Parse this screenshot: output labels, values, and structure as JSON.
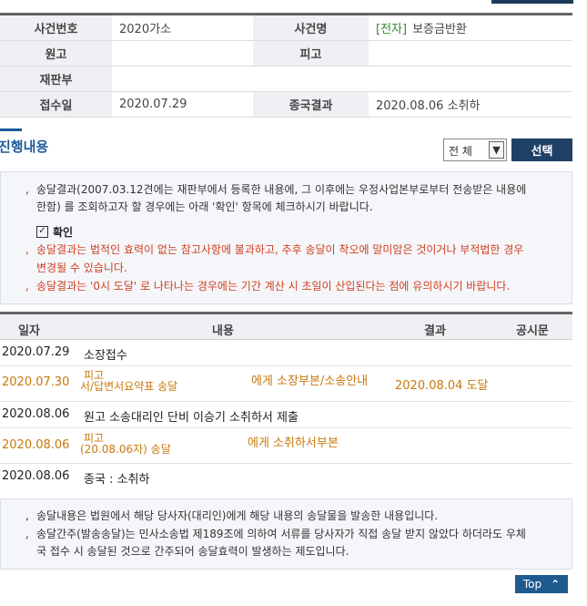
{
  "case_info": {
    "case_number_label": "사건번호",
    "case_number": "2020가소",
    "case_name_label": "사건명",
    "case_name_tag": "[전자]",
    "case_name": "보증금반환",
    "plaintiff_label": "원고",
    "plaintiff": "",
    "defendant_label": "피고",
    "defendant": "",
    "court_label": "재판부",
    "court": "",
    "filing_date_label": "접수일",
    "filing_date": "2020.07.29",
    "result_label": "종국결과",
    "result": "2020.08.06 소취하"
  },
  "progress_section": {
    "title": "진행내용",
    "filter_value": "전 체",
    "select_button": "선택"
  },
  "notice": {
    "line1a": "송달결과(2007.03.12견에는 재판부에서 등록한 내용에, 그 이후에는 우정사업본부로부터 전송받은 내용에",
    "line1b": "한함) 를 조회하고자 할 경우에는 아래 '확인' 항목에 체크하시기 바랍니다.",
    "confirm_label": "확인",
    "line2a": "송달결과는 법적인 효력이 없는 참고사항에 불과하고, 추후 송달이 착오에 말미암은 것이거나 부적법한 경우",
    "line2b": "변경될 수 있습니다.",
    "line3": "송달결과는 '0시 도달' 로 나타나는 경우에는 기간 계산 시 초일이 산입된다는 점에 유의하시기 바랍니다."
  },
  "progress_table": {
    "headers": {
      "date": "일자",
      "content": "내용",
      "result": "결과",
      "notice": "공시문"
    },
    "rows": [
      {
        "date": "2020.07.29",
        "content": "소장접수",
        "content2": "",
        "content_extra": "",
        "result": ""
      },
      {
        "date": "2020.07.30",
        "content": "피고",
        "content2": "서/답변서요약표 송달",
        "content_extra": "에게 소장부본/소송안내",
        "result": "2020.08.04 도달"
      },
      {
        "date": "2020.08.06",
        "content": "원고 소송대리인 단비 이승기 소취하서 제출",
        "content2": "",
        "content_extra": "",
        "result": ""
      },
      {
        "date": "2020.08.06",
        "content": "피고",
        "content2": "(20.08.06자) 송달",
        "content_extra": "에게 소취하서부본",
        "result": ""
      },
      {
        "date": "2020.08.06",
        "content": "종국 : 소취하",
        "content2": "",
        "content_extra": "",
        "result": ""
      }
    ]
  },
  "notice2": {
    "line1": "송달내용은 법원에서 해당 당사자(대리인)에게 해당 내용의 송달물을 발송한 내용입니다.",
    "line2a": "송달간주(발송송달)는 민사소송법 제189조에 의하여 서류를 당사자가 직접 송달 받지 않았다 하더라도 우체",
    "line2b": "국 접수 시 송달된 것으로 간주되어 송달효력이 발생하는 제도입니다."
  },
  "top_button": "Top",
  "colors": {
    "accent": "#1d5a9a",
    "button": "#1f4166",
    "orange": "#c8780a",
    "red": "#d04020"
  }
}
